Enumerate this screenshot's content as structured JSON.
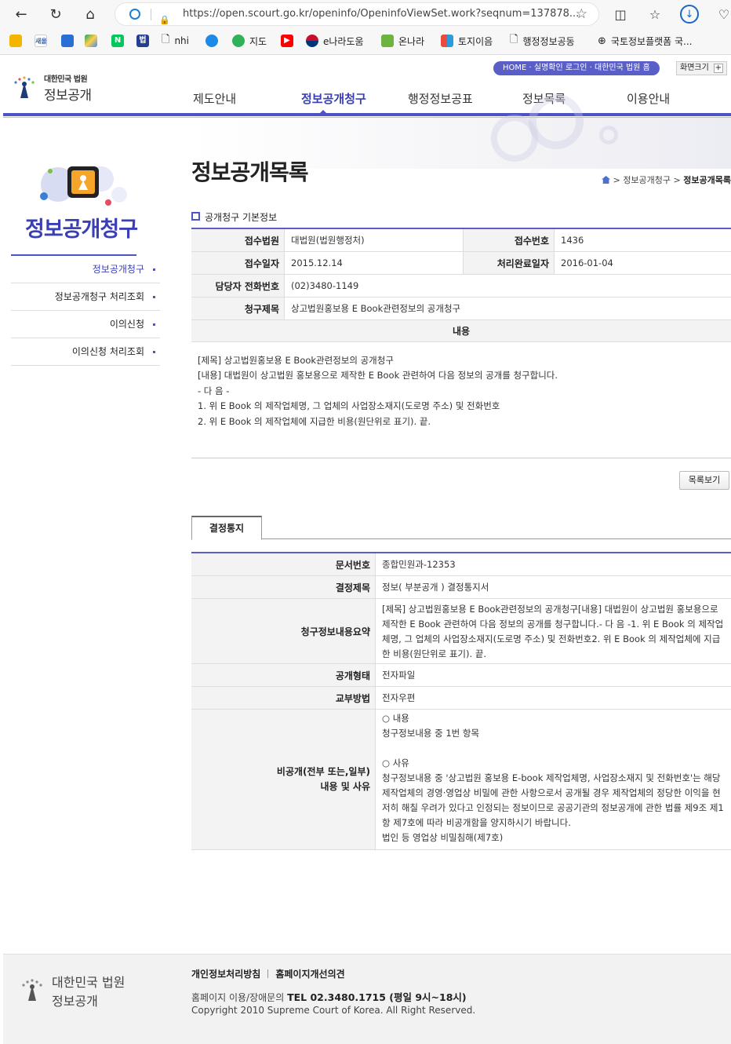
{
  "browser": {
    "url": "https://open.scourt.go.kr/openinfo/OpeninfoViewSet.work?seqnum=137878...",
    "bookmarks": [
      "새올",
      "",
      "",
      "",
      "N",
      "법",
      "nhi",
      "",
      "지도",
      "",
      "e나라도움",
      "온나라",
      "토지이음",
      "행정정보공동",
      "국토정보플랫폼 국..."
    ]
  },
  "header": {
    "logo_small": "대한민국 법원",
    "logo_big": "정보공개",
    "top_links": "HOME · 실명확인 로그인 · 대한민국 법원 홈",
    "zoom_label": "화면크기",
    "zoom_plus": "+",
    "nav": [
      "제도안내",
      "정보공개청구",
      "행정정보공표",
      "정보목록",
      "이용안내"
    ]
  },
  "sidebar": {
    "title": "정보공개청구",
    "items": [
      "정보공개청구",
      "정보공개청구 처리조회",
      "이의신청",
      "이의신청 처리조회"
    ]
  },
  "page": {
    "title": "정보공개목록",
    "breadcrumb_1": "정보공개청구",
    "breadcrumb_2": "정보공개목록",
    "section_title": "공개청구 기본정보"
  },
  "info": {
    "court_label": "접수법원",
    "court_value": "대법원(법원행정처)",
    "receipt_no_label": "접수번호",
    "receipt_no_value": "1436",
    "receipt_date_label": "접수일자",
    "receipt_date_value": "2015.12.14",
    "done_date_label": "처리완료일자",
    "done_date_value": "2016-01-04",
    "phone_label": "담당자 전화번호",
    "phone_value": "(02)3480-1149",
    "subject_label": "청구제목",
    "subject_value": "상고법원홍보용 E Book관련정보의 공개청구",
    "content_label": "내용",
    "content_lines": [
      "[제목] 상고법원홍보용 E Book관련정보의 공개청구",
      "[내용] 대법원이 상고법원 홍보용으로 제작한 E Book 관련하여 다음 정보의 공개를 청구합니다.",
      "- 다 음 -",
      "1. 위 E Book 의 제작업체명, 그 업체의 사업장소재지(도로명 주소) 및 전화번호",
      "2. 위 E Book 의 제작업체에 지급한 비용(원단위로 표기). 끝."
    ],
    "list_button": "목록보기"
  },
  "decision": {
    "tab": "결정통지",
    "doc_no_label": "문서번호",
    "doc_no_value": "종합민원과-12353",
    "title_label": "결정제목",
    "title_value": "정보( 부분공개 ) 결정통지서",
    "summary_label": "청구정보내용요약",
    "summary_value": "[제목] 상고법원홍보용 E Book관련정보의 공개청구[내용] 대법원이 상고법원 홍보용으로 제작한 E Book 관련하여 다음 정보의 공개를 청구합니다.- 다 음 -1. 위 E Book 의 제작업체명, 그 업체의 사업장소재지(도로명 주소) 및 전화번호2. 위 E Book 의 제작업체에 지급한 비용(원단위로 표기). 끝.",
    "form_label": "공개형태",
    "form_value": "전자파일",
    "method_label": "교부방법",
    "method_value": "전자우편",
    "reason_label_1": "비공개(전부 또는,일부)",
    "reason_label_2": "내용 및 사유",
    "reason_lines": [
      "○ 내용",
      "청구정보내용 중 1번 항목",
      "",
      "○ 사유",
      "청구정보내용 중 '상고법원 홍보용 E-book 제작업체명, 사업장소재지 및 전화번호'는 해당 제작업체의 경영·영업상 비밀에 관한 사항으로서 공개될 경우 제작업체의 정당한 이익을 현저히 해칠 우려가 있다고 인정되는 정보이므로 공공기관의 정보공개에 관한 법률 제9조 제1항 제7호에 따라 비공개함을 양지하시기 바랍니다.",
      "법인 등 영업상 비밀침해(제7호)"
    ]
  },
  "footer": {
    "logo_small": "대한민국 법원",
    "logo_big": "정보공개",
    "link_privacy": "개인정보처리방침",
    "link_improve": "홈페이지개선의견",
    "tel_prefix": "홈페이지 이용/장애문의",
    "tel": "TEL 02.3480.1715 (평일 9시~18시)",
    "copyright": "Copyright 2010 Supreme Court of Korea.  All Right Reserved."
  }
}
